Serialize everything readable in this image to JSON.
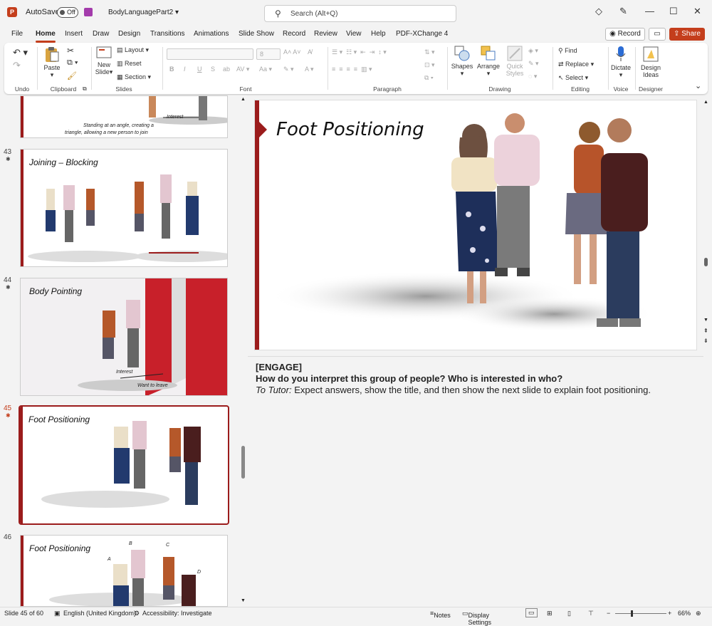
{
  "titlebar": {
    "autosave_label": "AutoSave",
    "autosave_state": "Off",
    "filename": "BodyLanguagePart2",
    "search_placeholder": "Search (Alt+Q)",
    "minimize": "—",
    "maximize": "☐",
    "close": "✕"
  },
  "menu": {
    "tabs": [
      "File",
      "Home",
      "Insert",
      "Draw",
      "Design",
      "Transitions",
      "Animations",
      "Slide Show",
      "Record",
      "Review",
      "View",
      "Help",
      "PDF-XChange 4"
    ],
    "active_tab": "Home",
    "record_label": "Record",
    "share_label": "Share"
  },
  "ribbon": {
    "groups": {
      "undo": "Undo",
      "clipboard": "Clipboard",
      "slides": "Slides",
      "font": "Font",
      "paragraph": "Paragraph",
      "drawing": "Drawing",
      "editing": "Editing",
      "voice": "Voice",
      "designer": "Designer"
    },
    "paste": "Paste",
    "new_slide": "New Slide",
    "layout": "Layout",
    "reset": "Reset",
    "section": "Section",
    "font_size": "8",
    "shapes": "Shapes",
    "arrange": "Arrange",
    "quick_styles": "Quick Styles",
    "find": "Find",
    "replace": "Replace",
    "select": "Select",
    "dictate": "Dictate",
    "design_ideas": "Design Ideas"
  },
  "slides": [
    {
      "number": "",
      "title": "",
      "caption_1": "Standing at an angle, creating a",
      "caption_2": "triangle, allowing a new person to join",
      "label": "Interest"
    },
    {
      "number": "43",
      "title": "Joining – Blocking"
    },
    {
      "number": "44",
      "title": "Body Pointing",
      "label_1": "Interest",
      "label_2": "Want to leave"
    },
    {
      "number": "45",
      "title": "Foot Positioning"
    },
    {
      "number": "46",
      "title": "Foot Positioning",
      "letters": [
        "A",
        "B",
        "C",
        "D"
      ]
    }
  ],
  "current_slide": {
    "title": "Foot Positioning"
  },
  "notes": {
    "line1": "[ENGAGE]",
    "line2": "How do you interpret this group of people? Who is interested in who?",
    "tutor_label": "To Tutor:",
    "tutor_text": " Expect answers, show the title, and then show the next slide to explain foot positioning."
  },
  "status": {
    "slide_count": "Slide 45 of 60",
    "language": "English (United Kingdom)",
    "accessibility": "Accessibility: Investigate",
    "notes": "Notes",
    "display_settings": "Display Settings",
    "zoom": "66%",
    "zoom_level": 0.66
  },
  "colors": {
    "accent": "#c43e1c",
    "slide_bar": "#9b1c1c"
  }
}
